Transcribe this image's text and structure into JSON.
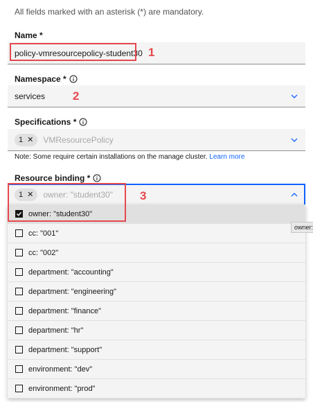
{
  "form_note": "All fields marked with an asterisk (*) are mandatory.",
  "name": {
    "label": "Name *",
    "value": "policy-vmresourcepolicy-student30"
  },
  "namespace": {
    "label": "Namespace *",
    "value": "services"
  },
  "specifications": {
    "label": "Specifications *",
    "tag_count": "1",
    "placeholder": "VMResourcePolicy"
  },
  "spec_note": "Note: Some require certain installations on the manage cluster.",
  "learn_more": "Learn more",
  "resource_binding": {
    "label": "Resource binding *",
    "tag_count": "1",
    "placeholder": "owner: \"student30\"",
    "options": [
      {
        "label": "owner: \"student30\"",
        "checked": true
      },
      {
        "label": "cc: \"001\"",
        "checked": false
      },
      {
        "label": "cc: \"002\"",
        "checked": false
      },
      {
        "label": "department: \"accounting\"",
        "checked": false
      },
      {
        "label": "department: \"engineering\"",
        "checked": false
      },
      {
        "label": "department: \"finance\"",
        "checked": false
      },
      {
        "label": "department: \"hr\"",
        "checked": false
      },
      {
        "label": "department: \"support\"",
        "checked": false
      },
      {
        "label": "environment: \"dev\"",
        "checked": false
      },
      {
        "label": "environment: \"prod\"",
        "checked": false
      }
    ]
  },
  "tooltip": "owner: \"",
  "annotations": [
    "1",
    "2",
    "3"
  ],
  "colors": {
    "accent": "#0f62fe",
    "annotation": "#e5484d",
    "field_bg": "#f4f4f4"
  }
}
